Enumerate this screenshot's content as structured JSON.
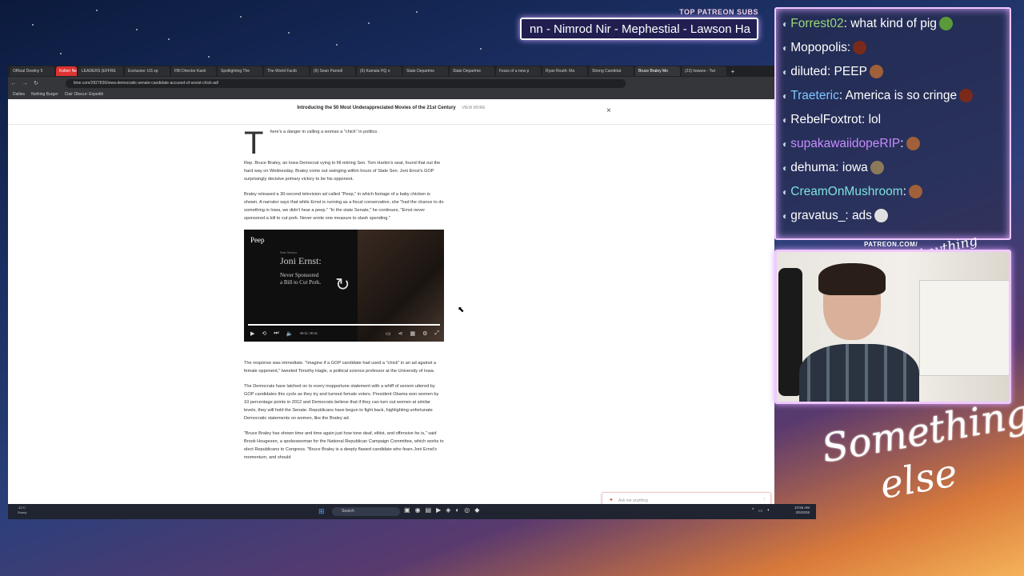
{
  "overlay": {
    "patreon_label": "TOP PATREON SUBS",
    "patreon_ticker": "nn - Nimrod Nir - Mephestial - Lawson Ha",
    "patreon_url": "PATREON.COM/",
    "brand_top": "Anything",
    "brand_line1": "Something",
    "brand_line2": "else"
  },
  "browser": {
    "tabs": [
      {
        "label": "Official Destiny 5"
      },
      {
        "label": "Kolten News"
      },
      {
        "label": "LEADERS (EFFRE"
      },
      {
        "label": "Exclusive: US sp"
      },
      {
        "label": "FBI Director Kash"
      },
      {
        "label": "Spotlighting The"
      },
      {
        "label": "The World Factb"
      },
      {
        "label": "(6) Sean Parnell"
      },
      {
        "label": "(6) Kamala HQ o"
      },
      {
        "label": "State Departme"
      },
      {
        "label": "State Departme"
      },
      {
        "label": "Fears of a new p"
      },
      {
        "label": "Ryan Routh: Ma"
      },
      {
        "label": "Strong Candidat"
      },
      {
        "label": "Bruce Braley Mo"
      },
      {
        "label": "(23) Iowans - Twi"
      }
    ],
    "url": "time.com/2827836/iowa-democratic-senate-candidate-accused-of-sexist-chick-ad/",
    "bookmarks": [
      "Dailies",
      "Nothing Burger",
      "Clair Obscur: Expediti"
    ]
  },
  "page": {
    "promo_text": "Introducing the 50 Most Underappreciated Movies of the 21st Century",
    "promo_link": "VIEW MORE",
    "dropcap": "T",
    "p1": "here's a danger in calling a woman a \"chick\" in politics.",
    "p2": "Rep. Bruce Braley, an Iowa Democrat vying to fill retiring Sen. Tom Harkin's seat, found that out the hard way on Wednesday. Braley come out swinging within hours of State Sen. Joni Ernst's GOP surprisingly decisive primary victory to be his opponent.",
    "p3": "Braley released a 30-second television ad called \"Peep,\" in which footage of a baby chicken is shown. A narrator says that while Ernst is running as a fiscal conservative, she \"had the chance to do something in Iowa, we didn't hear a peep.\" \"In the state Senate,\" he continues, \"Ernst never sponsored a bill to cut pork. Never wrote one measure to slash spending.\"",
    "video": {
      "title": "Peep",
      "small_label": "State Senator",
      "name": "Joni Ernst:",
      "line1": "Never Sponsored",
      "line2": "a Bill to Cut Pork.",
      "time": "00:32 / 00:32"
    },
    "p4": "The response was immediate. \"Imagine if a GOP candidate had used a \"chick\" in an ad against a female opponent,\" tweeted Timothy Hagle, a political science professor at the University of Iowa.",
    "p5": "The Democrats have latched on to every inopportune statement with a whiff of sexism uttered by GOP candidates this cycle as they try and turnout female voters. President Obama won women by 10 percentage points in 2012 and Democrats believe that if they can turn out women at similar levels, they will hold the Senate. Republicans have begun to fight back, highlighting unfortunate Democratic statements on women, like the Braley ad.",
    "p6": "\"Bruce Braley has shown time and time again just how tone deaf, elitist, and offensive he is,\" said Brook Hougesen, a spokeswoman for the National Republican Campaign Committee, which works to elect Republicans to Congress. \"Bruce Braley is a deeply flawed candidate who fears Joni Ernst's momentum, and should",
    "ask_placeholder": "Ask me anything"
  },
  "taskbar": {
    "weather_temp": "-11°C",
    "weather_desc": "Sunny",
    "search_label": "Search",
    "time": "10:55 AM",
    "date": "2/5/2026"
  },
  "chat": {
    "messages": [
      {
        "user": "Forrest02",
        "color": "#9bd77a",
        "text": ": what kind of pig",
        "emote": "#5a9a3a"
      },
      {
        "user": "Mopopolis",
        "color": "#ffffff",
        "text": ":",
        "emote": "#7a2a1a"
      },
      {
        "user": "diluted",
        "color": "#ffffff",
        "text": ": PEEP",
        "emote": "#a0603a"
      },
      {
        "user": "Traeteric",
        "color": "#7ec8ff",
        "text": ": America is so cringe",
        "emote": "#7a2a1a"
      },
      {
        "user": "RebelFoxtrot",
        "color": "#ffffff",
        "text": ": lol",
        "emote": ""
      },
      {
        "user": "supakawaiidopeRIP",
        "color": "#c88cff",
        "text": ":",
        "emote": "#a0603a"
      },
      {
        "user": "dehuma",
        "color": "#ffffff",
        "text": ": iowa",
        "emote": "#8a7a5a"
      },
      {
        "user": "CreamOnMushroom",
        "color": "#7fe0e0",
        "text": ":",
        "emote": "#a0603a"
      },
      {
        "user": "gravatus_",
        "color": "#ffffff",
        "text": ": ads",
        "emote": "#e0e0e0"
      }
    ]
  }
}
